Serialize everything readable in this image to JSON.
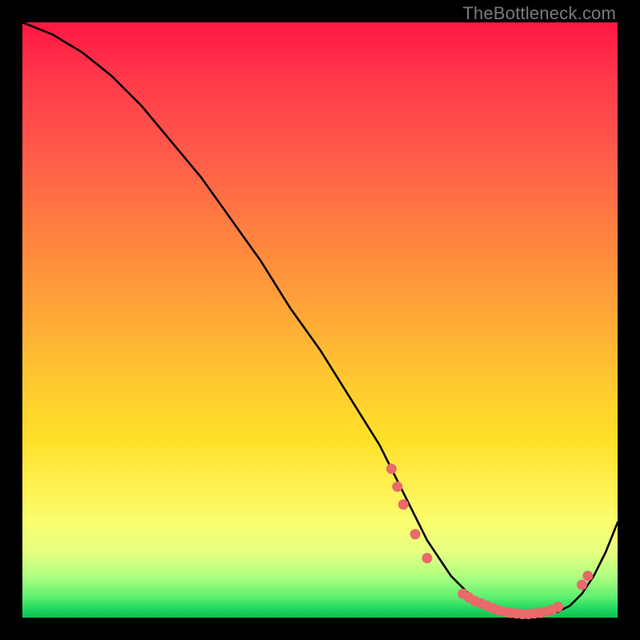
{
  "watermark": "TheBottleneck.com",
  "chart_data": {
    "type": "line",
    "title": "",
    "xlabel": "",
    "ylabel": "",
    "xlim": [
      0,
      100
    ],
    "ylim": [
      0,
      100
    ],
    "series": [
      {
        "name": "curve",
        "x": [
          0,
          5,
          10,
          15,
          20,
          25,
          30,
          35,
          40,
          45,
          50,
          55,
          60,
          62,
          64,
          66,
          68,
          70,
          72,
          74,
          76,
          78,
          80,
          82,
          84,
          86,
          88,
          90,
          92,
          94,
          96,
          98,
          100
        ],
        "y": [
          100,
          98,
          95,
          91,
          86,
          80,
          74,
          67,
          60,
          52,
          45,
          37,
          29,
          25,
          21,
          17,
          13,
          10,
          7,
          5,
          3,
          2,
          1,
          0.6,
          0.4,
          0.4,
          0.6,
          1,
          2,
          4,
          7,
          11,
          16
        ]
      }
    ],
    "markers": {
      "name": "highlight-dots",
      "color": "#e86a6a",
      "points": [
        {
          "x": 62,
          "y": 25
        },
        {
          "x": 63,
          "y": 22
        },
        {
          "x": 64,
          "y": 19
        },
        {
          "x": 66,
          "y": 14
        },
        {
          "x": 68,
          "y": 10
        },
        {
          "x": 74,
          "y": 4
        },
        {
          "x": 75,
          "y": 3.4
        },
        {
          "x": 76,
          "y": 2.8
        },
        {
          "x": 77,
          "y": 2.4
        },
        {
          "x": 78,
          "y": 2.0
        },
        {
          "x": 79,
          "y": 1.6
        },
        {
          "x": 80,
          "y": 1.2
        },
        {
          "x": 81,
          "y": 1.0
        },
        {
          "x": 82,
          "y": 0.8
        },
        {
          "x": 83,
          "y": 0.7
        },
        {
          "x": 84,
          "y": 0.6
        },
        {
          "x": 85,
          "y": 0.6
        },
        {
          "x": 86,
          "y": 0.7
        },
        {
          "x": 87,
          "y": 0.8
        },
        {
          "x": 88,
          "y": 1.0
        },
        {
          "x": 89,
          "y": 1.3
        },
        {
          "x": 90,
          "y": 1.8
        },
        {
          "x": 94,
          "y": 5.5
        },
        {
          "x": 95,
          "y": 7.0
        }
      ]
    },
    "background_gradient": {
      "top": "#ff1744",
      "mid": "#ffe028",
      "bottom": "#10c050"
    }
  }
}
